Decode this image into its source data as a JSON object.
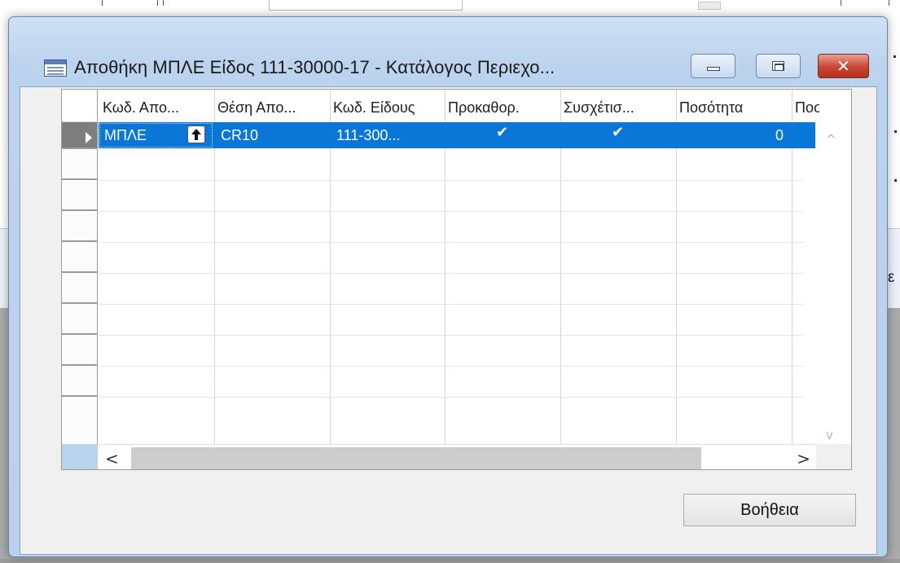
{
  "window": {
    "title": "Αποθήκη ΜΠΛΕ Είδος 111-30000-17 - Κατάλογος Περιεχο...",
    "close_glyph": "✕"
  },
  "grid": {
    "columns": [
      "Κωδ. Απο...",
      "Θέση Απο...",
      "Κωδ. Είδους",
      "Προκαθορ.",
      "Συσχέτισ...",
      "Ποσότητα",
      "Ποσ"
    ],
    "rows": [
      {
        "location_code": "ΜΠΛΕ",
        "bin_code": "CR10",
        "item_no": "111-300...",
        "default": "✔",
        "related": "✔",
        "quantity": "0"
      }
    ],
    "empty_rows": 9
  },
  "scroll": {
    "up": "^",
    "down": "v",
    "left": "<",
    "right": ">"
  },
  "buttons": {
    "help": "Βοήθεια"
  },
  "background": {
    "partial_char": "ε"
  }
}
